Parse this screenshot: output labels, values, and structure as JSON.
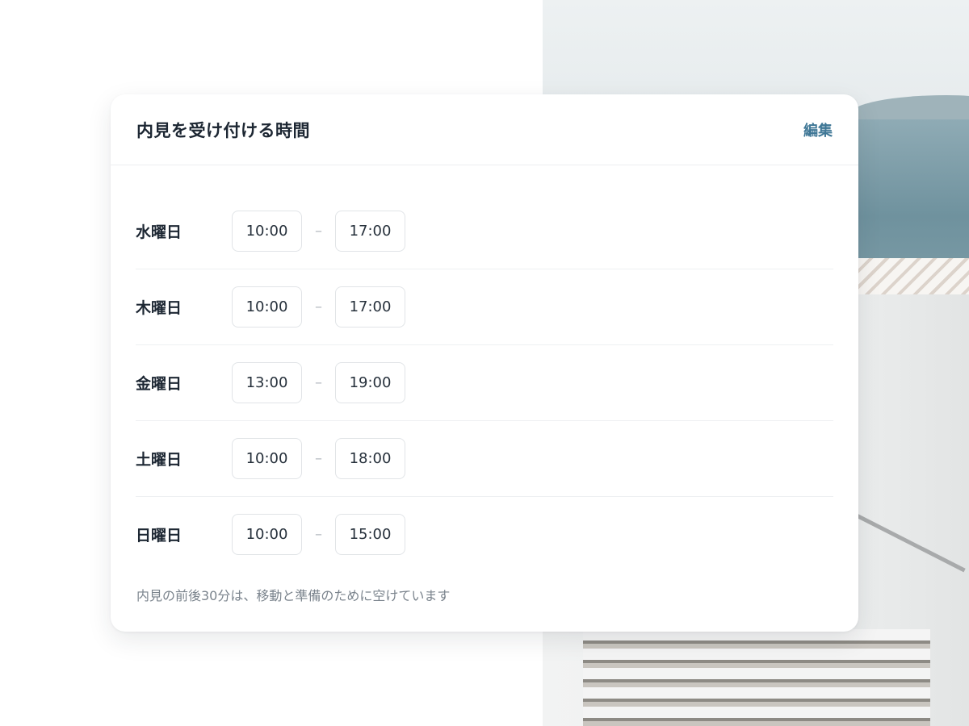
{
  "card": {
    "title": "内見を受け付ける時間",
    "edit_label": "編集",
    "footnote": "内見の前後30分は、移動と準備のために空けています"
  },
  "schedule": [
    {
      "day": "水曜日",
      "start": "10:00",
      "end": "17:00"
    },
    {
      "day": "木曜日",
      "start": "10:00",
      "end": "17:00"
    },
    {
      "day": "金曜日",
      "start": "13:00",
      "end": "19:00"
    },
    {
      "day": "土曜日",
      "start": "10:00",
      "end": "18:00"
    },
    {
      "day": "日曜日",
      "start": "10:00",
      "end": "15:00"
    }
  ],
  "separator": "–",
  "colors": {
    "accent": "#3f7796",
    "text": "#1d2733",
    "muted": "#7b848d",
    "border": "#e1e4e7"
  }
}
